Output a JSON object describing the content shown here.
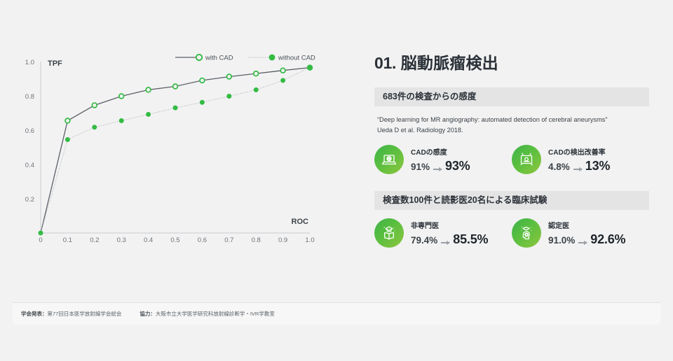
{
  "chart_data": {
    "type": "line",
    "title": "",
    "xlabel": "ROC",
    "ylabel": "TPF",
    "xlim": [
      0,
      1.0
    ],
    "ylim": [
      0,
      1.0
    ],
    "grid": false,
    "legend_position": "top-right",
    "x_ticks": [
      "0",
      "0.1",
      "0.2",
      "0.3",
      "0.4",
      "0.5",
      "0.6",
      "0.7",
      "0.8",
      "0.9",
      "1.0"
    ],
    "y_ticks": [
      "0.2",
      "0.4",
      "0.6",
      "0.8",
      "1.0"
    ],
    "x": [
      0,
      0.1,
      0.2,
      0.3,
      0.4,
      0.5,
      0.6,
      0.7,
      0.8,
      0.9,
      1.0
    ],
    "series": [
      {
        "name": "with CAD",
        "marker": "open-circle",
        "line": "solid",
        "color": "#33bb44",
        "line_color": "#5a5f66",
        "values": [
          0.0,
          0.655,
          0.745,
          0.798,
          0.835,
          0.855,
          0.89,
          0.912,
          0.93,
          0.948,
          0.965
        ]
      },
      {
        "name": "without CAD",
        "marker": "filled-circle",
        "line": "dotted",
        "color": "#33bb44",
        "line_color": "#b9bcc0",
        "values": [
          0.0,
          0.545,
          0.617,
          0.655,
          0.692,
          0.73,
          0.762,
          0.798,
          0.835,
          0.89,
          0.965
        ]
      }
    ]
  },
  "content": {
    "deck_title_number": "01.",
    "deck_title_text": "脳動脈瘤検出",
    "section_one": {
      "header": "683件の検査からの感度",
      "citation_line1": "“Deep learning for MR angiography: automated detection of cerebral aneurysms”",
      "citation_line2": "Ueda D et al. Radiology 2018.",
      "stats": [
        {
          "icon": "laptop-brain-icon",
          "label": "CADの感度",
          "value_from": "91%",
          "value_to": "93%"
        },
        {
          "icon": "monitor-detection-icon",
          "label": "CADの検出改善率",
          "value_from": "4.8%",
          "value_to": "13%"
        }
      ]
    },
    "section_two": {
      "header": "検査数100件と読影医20名による臨床試験",
      "stats": [
        {
          "icon": "book-graduate-icon",
          "label": "非専門医",
          "value_from": "79.4%",
          "value_to": "85.5%"
        },
        {
          "icon": "head-knowledge-icon",
          "label": "認定医",
          "value_from": "91.0%",
          "value_to": "92.6%"
        }
      ]
    }
  },
  "footer": {
    "presentation_key": "学会発表：",
    "presentation_value": "第77回日本医学放射線学会総会",
    "collaboration_key": "協力：",
    "collaboration_value": "大阪市立大学医学研究科放射線診断学・IVR学教室"
  },
  "colors": {
    "accent_green": "#33bb44",
    "page_background": "#f2f2f2",
    "section_bar": "#e4e4e4",
    "text_dark": "#2b3138"
  }
}
